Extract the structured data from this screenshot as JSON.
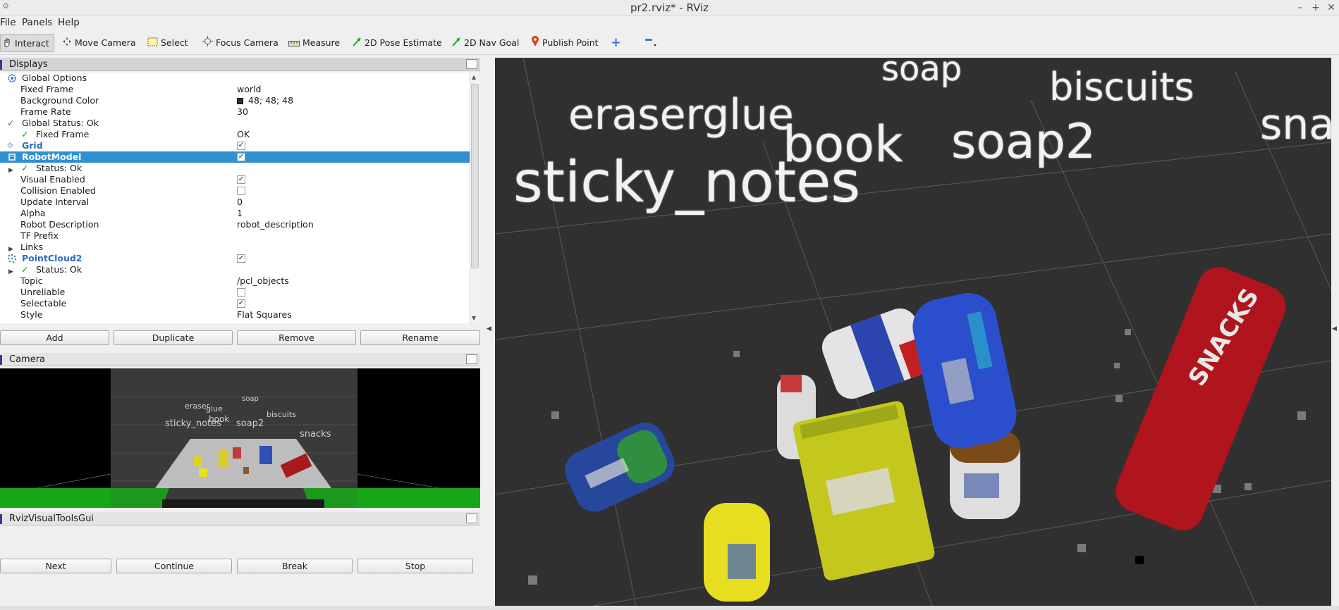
{
  "window": {
    "title": "pr2.rviz* - RViz"
  },
  "menu": [
    "File",
    "Panels",
    "Help"
  ],
  "toolbar": {
    "interact": "Interact",
    "move_camera": "Move Camera",
    "select": "Select",
    "focus_camera": "Focus Camera",
    "measure": "Measure",
    "pose_estimate": "2D Pose Estimate",
    "nav_goal": "2D Nav Goal",
    "publish_point": "Publish Point"
  },
  "displays": {
    "title": "Displays",
    "rows": [
      {
        "name": "Global Options",
        "value": ""
      },
      {
        "name": "Fixed Frame",
        "value": "world"
      },
      {
        "name": "Background Color",
        "value": "48; 48; 48"
      },
      {
        "name": "Frame Rate",
        "value": "30"
      },
      {
        "name": "Global Status: Ok",
        "value": ""
      },
      {
        "name": "Fixed Frame",
        "value": "OK"
      },
      {
        "name": "Grid",
        "value": ""
      },
      {
        "name": "RobotModel",
        "value": ""
      },
      {
        "name": "Status: Ok",
        "value": ""
      },
      {
        "name": "Visual Enabled",
        "value": ""
      },
      {
        "name": "Collision Enabled",
        "value": ""
      },
      {
        "name": "Update Interval",
        "value": "0"
      },
      {
        "name": "Alpha",
        "value": "1"
      },
      {
        "name": "Robot Description",
        "value": "robot_description"
      },
      {
        "name": "TF Prefix",
        "value": ""
      },
      {
        "name": "Links",
        "value": ""
      },
      {
        "name": "PointCloud2",
        "value": ""
      },
      {
        "name": "Status: Ok",
        "value": ""
      },
      {
        "name": "Topic",
        "value": "/pcl_objects"
      },
      {
        "name": "Unreliable",
        "value": ""
      },
      {
        "name": "Selectable",
        "value": ""
      },
      {
        "name": "Style",
        "value": "Flat Squares"
      }
    ],
    "buttons": {
      "add": "Add",
      "duplicate": "Duplicate",
      "remove": "Remove",
      "rename": "Rename"
    }
  },
  "camera": {
    "title": "Camera",
    "labels": [
      "eraser",
      "glue",
      "soap",
      "biscuits",
      "book",
      "sticky_notes",
      "soap2",
      "snacks"
    ]
  },
  "tools_gui": {
    "title": "RvizVisualToolsGui",
    "buttons": {
      "next": "Next",
      "continue": "Continue",
      "break": "Break",
      "stop": "Stop"
    }
  },
  "scene": {
    "background": "#303030",
    "labels": [
      "soap",
      "biscuits",
      "eraserglue",
      "book",
      "soap2",
      "sna",
      "sticky_notes"
    ]
  },
  "colors": {
    "selection": "#3191d0",
    "ok_check": "#1a8a1a",
    "display_blue": "#2b6cc4"
  }
}
